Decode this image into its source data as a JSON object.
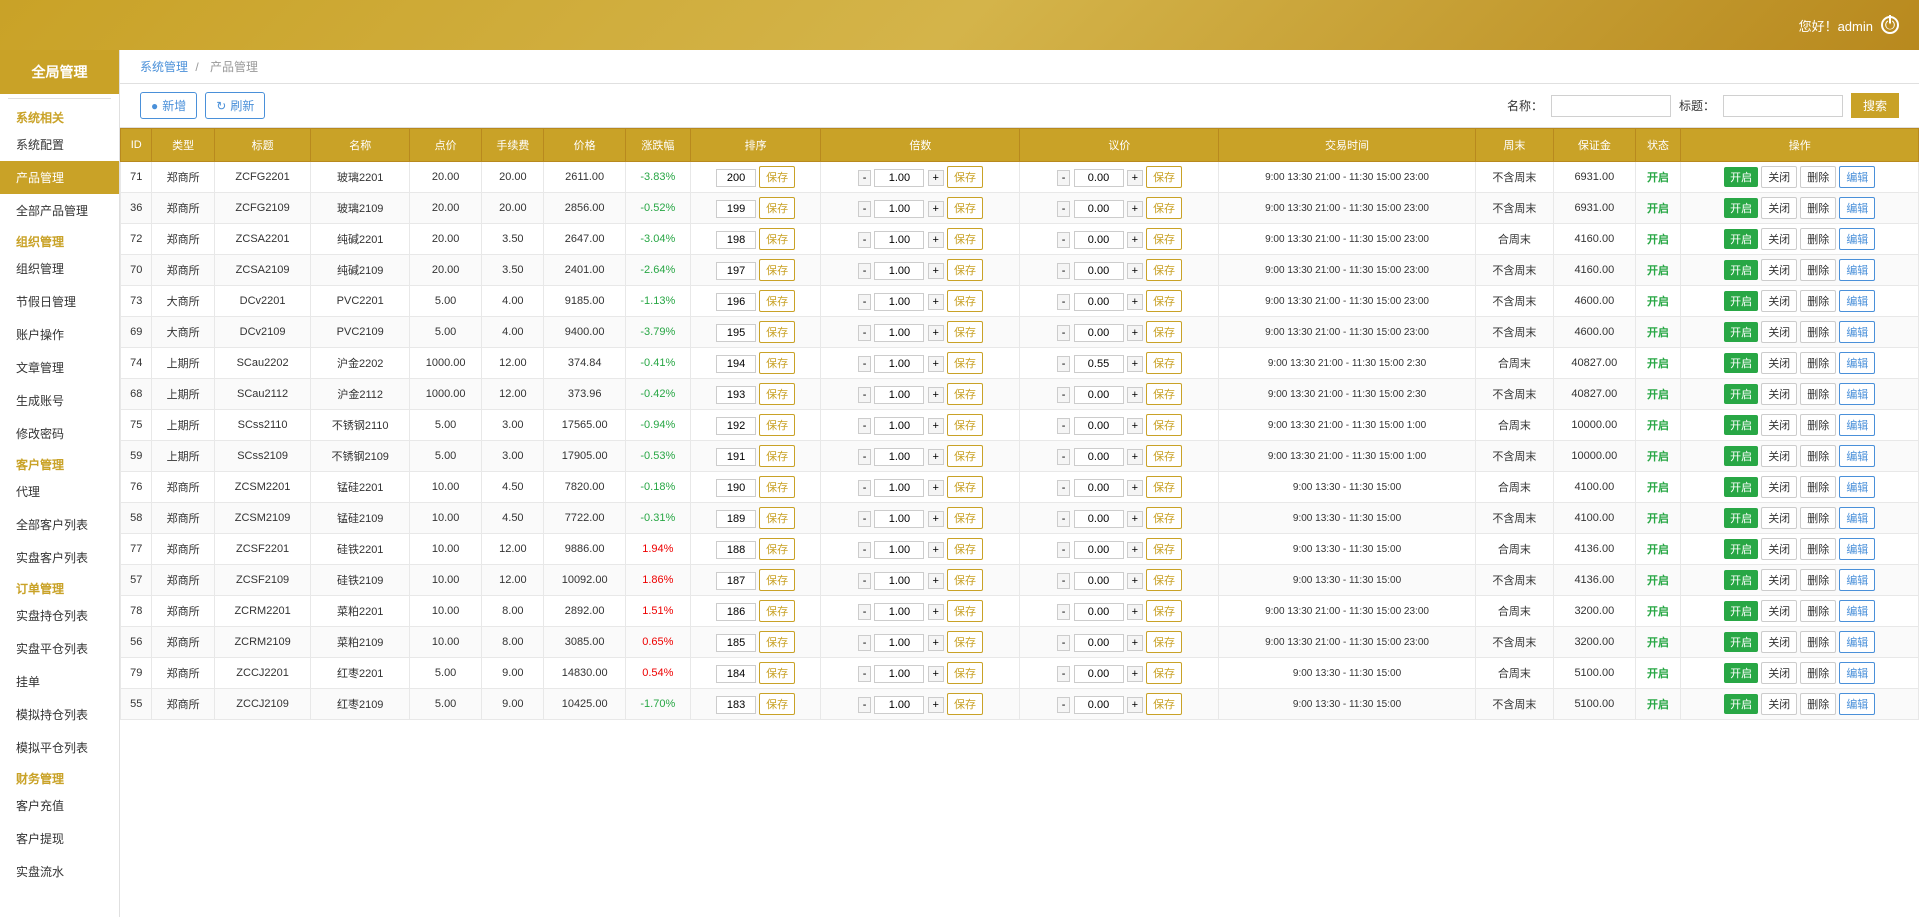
{
  "topbar": {
    "greeting": "您好！admin",
    "power_label": "⏻"
  },
  "sidebar": {
    "logo": "全局管理",
    "categories": [
      {
        "label": "系统相关",
        "items": [
          "系统配置",
          "产品管理",
          "全部产品管理"
        ]
      },
      {
        "label": "组织管理",
        "items": [
          "组织管理",
          "节假日管理",
          "账户操作",
          "文章管理",
          "生成账号",
          "修改密码"
        ]
      },
      {
        "label": "客户管理",
        "items": [
          "代理",
          "全部客户列表",
          "实盘客户列表"
        ]
      },
      {
        "label": "订单管理",
        "items": [
          "实盘持仓列表",
          "实盘平仓列表",
          "挂单",
          "模拟持仓列表",
          "模拟平仓列表"
        ]
      },
      {
        "label": "财务管理",
        "items": [
          "客户充值",
          "客户提现",
          "实盘流水"
        ]
      }
    ]
  },
  "breadcrumb": {
    "system": "系统管理",
    "separator": "/",
    "current": "产品管理"
  },
  "toolbar": {
    "add_label": "新增",
    "refresh_label": "刷新",
    "name_label": "名称：",
    "tag_label": "标题：",
    "search_label": "搜索"
  },
  "table": {
    "headers": [
      "ID",
      "类型",
      "标题",
      "名称",
      "点价",
      "手续费",
      "价格",
      "涨跌幅",
      "排序",
      "倍数",
      "议价",
      "交易时间",
      "周末",
      "保证金",
      "状态",
      "操作"
    ],
    "rows": [
      {
        "id": "71",
        "type": "郑商所",
        "title": "ZCFG2201",
        "name": "玻璃2201",
        "point": "20.00",
        "fee": "20.00",
        "price": "2611.00",
        "change": "-3.83%",
        "change_neg": true,
        "rank": "200",
        "multi": "1.00",
        "discuss": "0.00",
        "trade_time": "9:00 13:30 21:00 - 11:30 15:00 23:00",
        "weekend": "不含周末",
        "margin": "6931.00",
        "status": "开启"
      },
      {
        "id": "36",
        "type": "郑商所",
        "title": "ZCFG2109",
        "name": "玻璃2109",
        "point": "20.00",
        "fee": "20.00",
        "price": "2856.00",
        "change": "-0.52%",
        "change_neg": true,
        "rank": "199",
        "multi": "1.00",
        "discuss": "0.00",
        "trade_time": "9:00 13:30 21:00 - 11:30 15:00 23:00",
        "weekend": "不含周末",
        "margin": "6931.00",
        "status": "开启"
      },
      {
        "id": "72",
        "type": "郑商所",
        "title": "ZCSA2201",
        "name": "纯碱2201",
        "point": "20.00",
        "fee": "3.50",
        "price": "2647.00",
        "change": "-3.04%",
        "change_neg": true,
        "rank": "198",
        "multi": "1.00",
        "discuss": "0.00",
        "trade_time": "9:00 13:30 21:00 - 11:30 15:00 23:00",
        "weekend": "合周末",
        "margin": "4160.00",
        "status": "开启"
      },
      {
        "id": "70",
        "type": "郑商所",
        "title": "ZCSA2109",
        "name": "纯碱2109",
        "point": "20.00",
        "fee": "3.50",
        "price": "2401.00",
        "change": "-2.64%",
        "change_neg": true,
        "rank": "197",
        "multi": "1.00",
        "discuss": "0.00",
        "trade_time": "9:00 13:30 21:00 - 11:30 15:00 23:00",
        "weekend": "不含周末",
        "margin": "4160.00",
        "status": "开启"
      },
      {
        "id": "73",
        "type": "大商所",
        "title": "DCv2201",
        "name": "PVC2201",
        "point": "5.00",
        "fee": "4.00",
        "price": "9185.00",
        "change": "-1.13%",
        "change_neg": true,
        "rank": "196",
        "multi": "1.00",
        "discuss": "0.00",
        "trade_time": "9:00 13:30 21:00 - 11:30 15:00 23:00",
        "weekend": "不含周末",
        "margin": "4600.00",
        "status": "开启"
      },
      {
        "id": "69",
        "type": "大商所",
        "title": "DCv2109",
        "name": "PVC2109",
        "point": "5.00",
        "fee": "4.00",
        "price": "9400.00",
        "change": "-3.79%",
        "change_neg": true,
        "rank": "195",
        "multi": "1.00",
        "discuss": "0.00",
        "trade_time": "9:00 13:30 21:00 - 11:30 15:00 23:00",
        "weekend": "不含周末",
        "margin": "4600.00",
        "status": "开启"
      },
      {
        "id": "74",
        "type": "上期所",
        "title": "SCau2202",
        "name": "沪金2202",
        "point": "1000.00",
        "fee": "12.00",
        "price": "374.84",
        "change": "-0.41%",
        "change_neg": true,
        "rank": "194",
        "multi": "1.00",
        "discuss": "0.55",
        "trade_time": "9:00 13:30 21:00 - 11:30 15:00 2:30",
        "weekend": "合周末",
        "margin": "40827.00",
        "status": "开启"
      },
      {
        "id": "68",
        "type": "上期所",
        "title": "SCau2112",
        "name": "沪金2112",
        "point": "1000.00",
        "fee": "12.00",
        "price": "373.96",
        "change": "-0.42%",
        "change_neg": true,
        "rank": "193",
        "multi": "1.00",
        "discuss": "0.00",
        "trade_time": "9:00 13:30 21:00 - 11:30 15:00 2:30",
        "weekend": "不含周末",
        "margin": "40827.00",
        "status": "开启"
      },
      {
        "id": "75",
        "type": "上期所",
        "title": "SCss2110",
        "name": "不锈钢2110",
        "point": "5.00",
        "fee": "3.00",
        "price": "17565.00",
        "change": "-0.94%",
        "change_neg": true,
        "rank": "192",
        "multi": "1.00",
        "discuss": "0.00",
        "trade_time": "9:00 13:30 21:00 - 11:30 15:00 1:00",
        "weekend": "合周末",
        "margin": "10000.00",
        "status": "开启"
      },
      {
        "id": "59",
        "type": "上期所",
        "title": "SCss2109",
        "name": "不锈钢2109",
        "point": "5.00",
        "fee": "3.00",
        "price": "17905.00",
        "change": "-0.53%",
        "change_neg": true,
        "rank": "191",
        "multi": "1.00",
        "discuss": "0.00",
        "trade_time": "9:00 13:30 21:00 - 11:30 15:00 1:00",
        "weekend": "不含周末",
        "margin": "10000.00",
        "status": "开启"
      },
      {
        "id": "76",
        "type": "郑商所",
        "title": "ZCSM2201",
        "name": "锰硅2201",
        "point": "10.00",
        "fee": "4.50",
        "price": "7820.00",
        "change": "-0.18%",
        "change_neg": true,
        "rank": "190",
        "multi": "1.00",
        "discuss": "0.00",
        "trade_time": "9:00 13:30 - 11:30 15:00",
        "weekend": "合周末",
        "margin": "4100.00",
        "status": "开启"
      },
      {
        "id": "58",
        "type": "郑商所",
        "title": "ZCSM2109",
        "name": "锰硅2109",
        "point": "10.00",
        "fee": "4.50",
        "price": "7722.00",
        "change": "-0.31%",
        "change_neg": true,
        "rank": "189",
        "multi": "1.00",
        "discuss": "0.00",
        "trade_time": "9:00 13:30 - 11:30 15:00",
        "weekend": "不含周末",
        "margin": "4100.00",
        "status": "开启"
      },
      {
        "id": "77",
        "type": "郑商所",
        "title": "ZCSF2201",
        "name": "硅铁2201",
        "point": "10.00",
        "fee": "12.00",
        "price": "9886.00",
        "change": "1.94%",
        "change_neg": false,
        "rank": "188",
        "multi": "1.00",
        "discuss": "0.00",
        "trade_time": "9:00 13:30 - 11:30 15:00",
        "weekend": "合周末",
        "margin": "4136.00",
        "status": "开启"
      },
      {
        "id": "57",
        "type": "郑商所",
        "title": "ZCSF2109",
        "name": "硅铁2109",
        "point": "10.00",
        "fee": "12.00",
        "price": "10092.00",
        "change": "1.86%",
        "change_neg": false,
        "rank": "187",
        "multi": "1.00",
        "discuss": "0.00",
        "trade_time": "9:00 13:30 - 11:30 15:00",
        "weekend": "不含周末",
        "margin": "4136.00",
        "status": "开启"
      },
      {
        "id": "78",
        "type": "郑商所",
        "title": "ZCRM2201",
        "name": "菜粕2201",
        "point": "10.00",
        "fee": "8.00",
        "price": "2892.00",
        "change": "1.51%",
        "change_neg": false,
        "rank": "186",
        "multi": "1.00",
        "discuss": "0.00",
        "trade_time": "9:00 13:30 21:00 - 11:30 15:00 23:00",
        "weekend": "合周末",
        "margin": "3200.00",
        "status": "开启"
      },
      {
        "id": "56",
        "type": "郑商所",
        "title": "ZCRM2109",
        "name": "菜粕2109",
        "point": "10.00",
        "fee": "8.00",
        "price": "3085.00",
        "change": "0.65%",
        "change_neg": false,
        "rank": "185",
        "multi": "1.00",
        "discuss": "0.00",
        "trade_time": "9:00 13:30 21:00 - 11:30 15:00 23:00",
        "weekend": "不含周末",
        "margin": "3200.00",
        "status": "开启"
      },
      {
        "id": "79",
        "type": "郑商所",
        "title": "ZCCJ2201",
        "name": "红枣2201",
        "point": "5.00",
        "fee": "9.00",
        "price": "14830.00",
        "change": "0.54%",
        "change_neg": false,
        "rank": "184",
        "multi": "1.00",
        "discuss": "0.00",
        "trade_time": "9:00 13:30 - 11:30 15:00",
        "weekend": "合周末",
        "margin": "5100.00",
        "status": "开启"
      },
      {
        "id": "55",
        "type": "郑商所",
        "title": "ZCCJ2109",
        "name": "红枣2109",
        "point": "5.00",
        "fee": "9.00",
        "price": "10425.00",
        "change": "-1.70%",
        "change_neg": true,
        "rank": "183",
        "multi": "1.00",
        "discuss": "0.00",
        "trade_time": "9:00 13:30 - 11:30 15:00",
        "weekend": "不含周末",
        "margin": "5100.00",
        "status": "开启"
      }
    ]
  },
  "actions": {
    "open": "开启",
    "close": "关闭",
    "delete": "删除",
    "edit": "编辑",
    "save": "保存"
  }
}
